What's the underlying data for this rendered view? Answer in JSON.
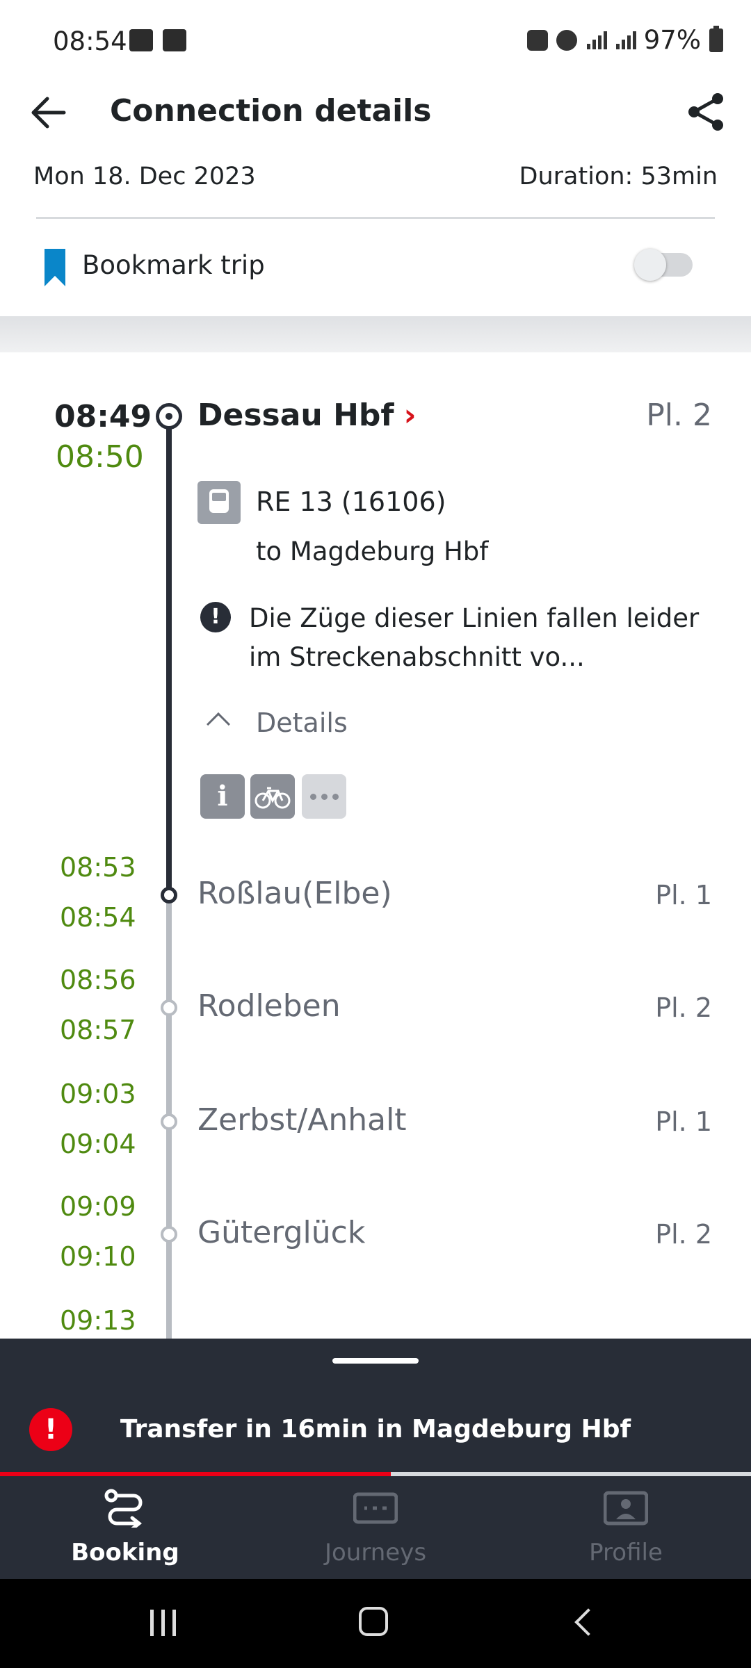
{
  "status_bar": {
    "time": "08:54",
    "battery": "97%"
  },
  "header": {
    "title": "Connection details"
  },
  "trip": {
    "date": "Mon 18. Dec 2023",
    "duration": "Duration: 53min"
  },
  "bookmark": {
    "label": "Bookmark trip",
    "enabled": false
  },
  "origin": {
    "scheduled": "08:49",
    "realtime": "08:50",
    "station": "Dessau Hbf",
    "platform": "Pl. 2"
  },
  "train": {
    "name": "RE 13 (16106)",
    "destination": "to Magdeburg Hbf",
    "notice": "Die Züge dieser Linien fallen leider im Streckenabschnitt vo...",
    "details_label": "Details",
    "info_glyph": "i"
  },
  "stops": [
    {
      "arr": "08:53",
      "dep": "08:54",
      "name": "Roßlau(Elbe)",
      "platform": "Pl. 1"
    },
    {
      "arr": "08:56",
      "dep": "08:57",
      "name": "Rodleben",
      "platform": "Pl. 2"
    },
    {
      "arr": "09:03",
      "dep": "09:04",
      "name": "Zerbst/Anhalt",
      "platform": "Pl. 1"
    },
    {
      "arr": "09:09",
      "dep": "09:10",
      "name": "Güterglück",
      "platform": "Pl. 2"
    },
    {
      "arr": "09:13"
    }
  ],
  "sheet": {
    "transfer_text": "Transfer in 16min in Magdeburg Hbf",
    "alert_glyph": "!",
    "progress": 0.52
  },
  "nav": {
    "items": [
      {
        "label": "Booking",
        "icon": "route-icon",
        "active": true
      },
      {
        "label": "Journeys",
        "icon": "ticket-icon",
        "active": false
      },
      {
        "label": "Profile",
        "icon": "profile-icon",
        "active": false
      }
    ]
  },
  "colors": {
    "realtime": "#4f8a10",
    "brand_red": "#ec0016",
    "bookmark": "#0a86c9",
    "dark": "#282d37"
  }
}
